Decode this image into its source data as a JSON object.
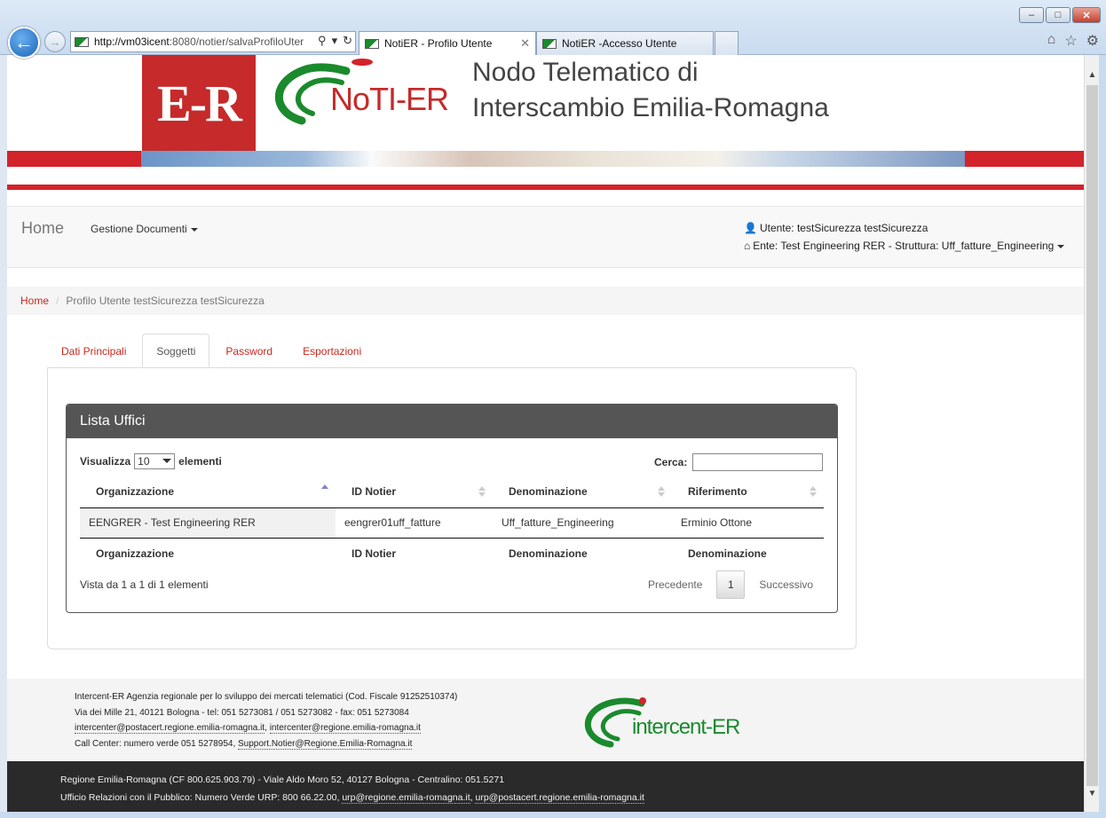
{
  "browser": {
    "url_host": "http://vm03icent",
    "url_rest": ":8080/notier/salvaProfiloUter",
    "tabs": [
      {
        "label": "NotiER - Profilo Utente",
        "active": true
      },
      {
        "label": "NotiER -Accesso Utente",
        "active": false
      }
    ]
  },
  "header": {
    "er_logo": "E-R",
    "noti_logo": "NoTI-ER",
    "title_line1": "Nodo Telematico di",
    "title_line2": "Interscambio Emilia-Romagna"
  },
  "navbar": {
    "home": "Home",
    "documents_menu": "Gestione Documenti",
    "user": "Utente: testSicurezza testSicurezza",
    "ente": "Ente: Test Engineering RER - Struttura: Uff_fatture_Engineering"
  },
  "breadcrumb": {
    "home": "Home",
    "current": "Profilo Utente testSicurezza testSicurezza"
  },
  "tabs": [
    {
      "label": "Dati Principali",
      "active": false
    },
    {
      "label": "Soggetti",
      "active": true
    },
    {
      "label": "Password",
      "active": false
    },
    {
      "label": "Esportazioni",
      "active": false
    }
  ],
  "panel": {
    "title": "Lista Uffici",
    "length_label_pre": "Visualizza",
    "length_value": "10",
    "length_label_post": "elementi",
    "search_label": "Cerca:",
    "search_value": "",
    "columns": [
      "Organizzazione",
      "ID Notier",
      "Denominazione",
      "Riferimento"
    ],
    "footer_columns": [
      "Organizzazione",
      "ID Notier",
      "Denominazione",
      "Denominazione"
    ],
    "rows": [
      [
        "EENGRER - Test Engineering RER",
        "eengrer01uff_fatture",
        "Uff_fatture_Engineering",
        "Erminio Ottone"
      ]
    ],
    "info": "Vista da 1 a 1 di 1 elementi",
    "prev": "Precedente",
    "page": "1",
    "next": "Successivo"
  },
  "footer": {
    "line1": "Intercent-ER Agenzia regionale per lo sviluppo dei mercati telematici (Cod. Fiscale 91252510374)",
    "line2": "Via dei Mille 21, 40121 Bologna - tel: 051 5273081 / 051 5273082 - fax: 051 5273084",
    "email1": "intercenter@postacert.regione.emilia-romagna.it",
    "email2": "intercenter@regione.emilia-romagna.it",
    "line4_pre": "Call Center: numero verde 051 5278954,",
    "support_email": "Support.Notier@Regione.Emilia-Romagna.it",
    "logo_text": "intercent-ER",
    "dark_line1": "Regione Emilia-Romagna (CF 800.625.903.79) - Viale Aldo Moro 52, 40127 Bologna - Centralino: 051.5271",
    "dark_line2_pre": "Ufficio Relazioni con il Pubblico: Numero Verde URP: 800 66.22.00,",
    "urp_email1": "urp@regione.emilia-romagna.it",
    "urp_email2": "urp@postacert.regione.emilia-romagna.it"
  },
  "colors": {
    "brand_red": "#d2232a",
    "link_red": "#c7281e",
    "panel_dark": "#555555",
    "logo_green": "#1a8a2d"
  }
}
